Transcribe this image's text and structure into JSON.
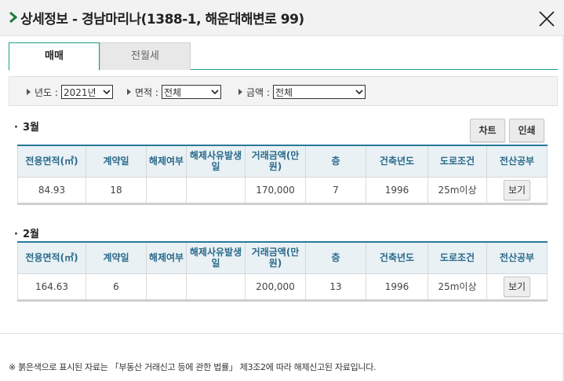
{
  "header": {
    "title": "상세정보 - 경남마리나(1388-1, 해운대해변로 99)",
    "chevron_icon": "chevron-right-icon",
    "close_icon": "close-icon"
  },
  "tabs": [
    {
      "label": "매매",
      "active": true
    },
    {
      "label": "전월세",
      "active": false
    }
  ],
  "filters": {
    "year": {
      "label": "년도 :",
      "value": "2021년"
    },
    "area": {
      "label": "면적 :",
      "value": "전체"
    },
    "amount": {
      "label": "금액 :",
      "value": "전체"
    }
  },
  "actions": {
    "chart_label": "차트",
    "print_label": "인쇄"
  },
  "columns": [
    "전용면적(㎡)",
    "계약일",
    "해제여부",
    "해제사유발생일",
    "거래금액(만원)",
    "층",
    "건축년도",
    "도로조건",
    "전산공부"
  ],
  "sections": [
    {
      "month": "3월",
      "row": {
        "area": "84.93",
        "contract_day": "18",
        "cancel": "",
        "cancel_date": "",
        "price": "170,000",
        "floor": "7",
        "built_year": "1996",
        "road": "25m이상",
        "view_label": "보기"
      }
    },
    {
      "month": "2월",
      "row": {
        "area": "164.63",
        "contract_day": "6",
        "cancel": "",
        "cancel_date": "",
        "price": "200,000",
        "floor": "13",
        "built_year": "1996",
        "road": "25m이상",
        "view_label": "보기"
      }
    }
  ],
  "footnote": "※ 붉은색으로 표시된 자료는 「부동산 거래신고 등에 관한 법률」 제3조2에 따라 해제신고된 자료입니다.",
  "colors": {
    "accent_green": "#1c9e8c",
    "header_blue": "#2a6a8a",
    "chevron_green": "#1d7a3e"
  }
}
